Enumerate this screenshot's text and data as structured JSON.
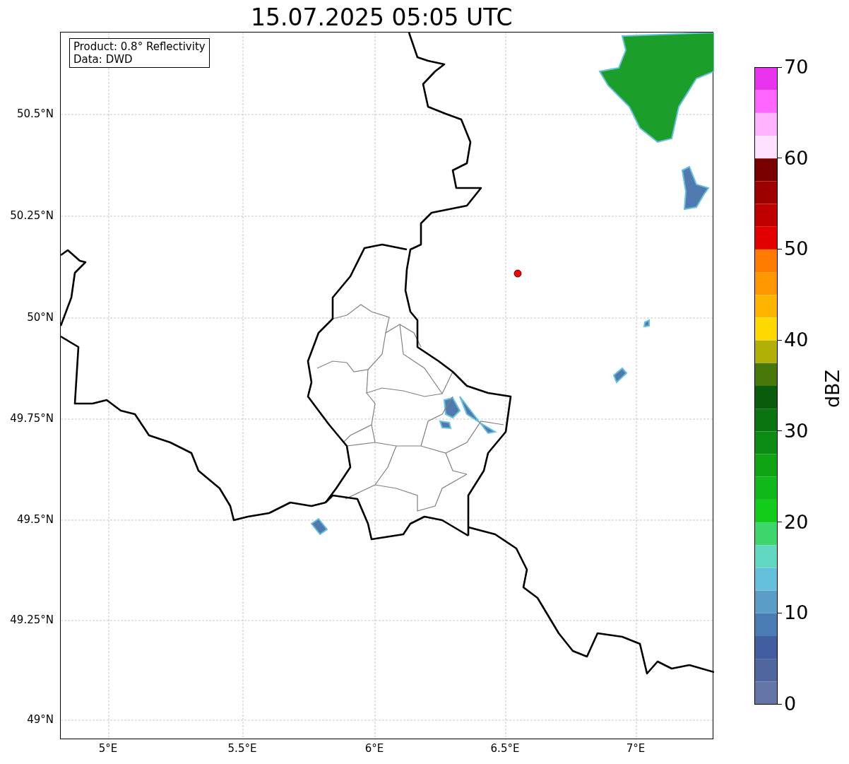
{
  "title": "15.07.2025 05:05 UTC",
  "info_box": [
    "Product: 0.8° Reflectivity",
    "Data: DWD"
  ],
  "map": {
    "y_ticks": [
      "50.5°N",
      "50.25°N",
      "50°N",
      "49.75°N",
      "49.5°N",
      "49.25°N",
      "49°N"
    ],
    "x_ticks": [
      "5°E",
      "5.5°E",
      "6°E",
      "6.5°E",
      "7°E"
    ]
  },
  "colorbar": {
    "label": "dBZ",
    "ticks": [
      "70",
      "60",
      "50",
      "40",
      "30",
      "20",
      "10",
      "0"
    ],
    "segments": [
      {
        "color": "#ea33ee"
      },
      {
        "color": "#ff66ff"
      },
      {
        "color": "#ffb2ff"
      },
      {
        "color": "#ffe0ff"
      },
      {
        "color": "#780000"
      },
      {
        "color": "#9e0000"
      },
      {
        "color": "#c00000"
      },
      {
        "color": "#e20000"
      },
      {
        "color": "#ff7c00"
      },
      {
        "color": "#ff9800"
      },
      {
        "color": "#ffb400"
      },
      {
        "color": "#ffd800"
      },
      {
        "color": "#b0b006"
      },
      {
        "color": "#48780a"
      },
      {
        "color": "#085c0c"
      },
      {
        "color": "#0a7410"
      },
      {
        "color": "#0c8c12"
      },
      {
        "color": "#0ea414"
      },
      {
        "color": "#10b81a"
      },
      {
        "color": "#12cc1a"
      },
      {
        "color": "#3cd66c"
      },
      {
        "color": "#60d8c2"
      },
      {
        "color": "#64c0dc"
      },
      {
        "color": "#5a9ec8"
      },
      {
        "color": "#4a7cb4"
      },
      {
        "color": "#425ea0"
      },
      {
        "color": "#50669e"
      },
      {
        "color": "#6476a8"
      }
    ]
  }
}
